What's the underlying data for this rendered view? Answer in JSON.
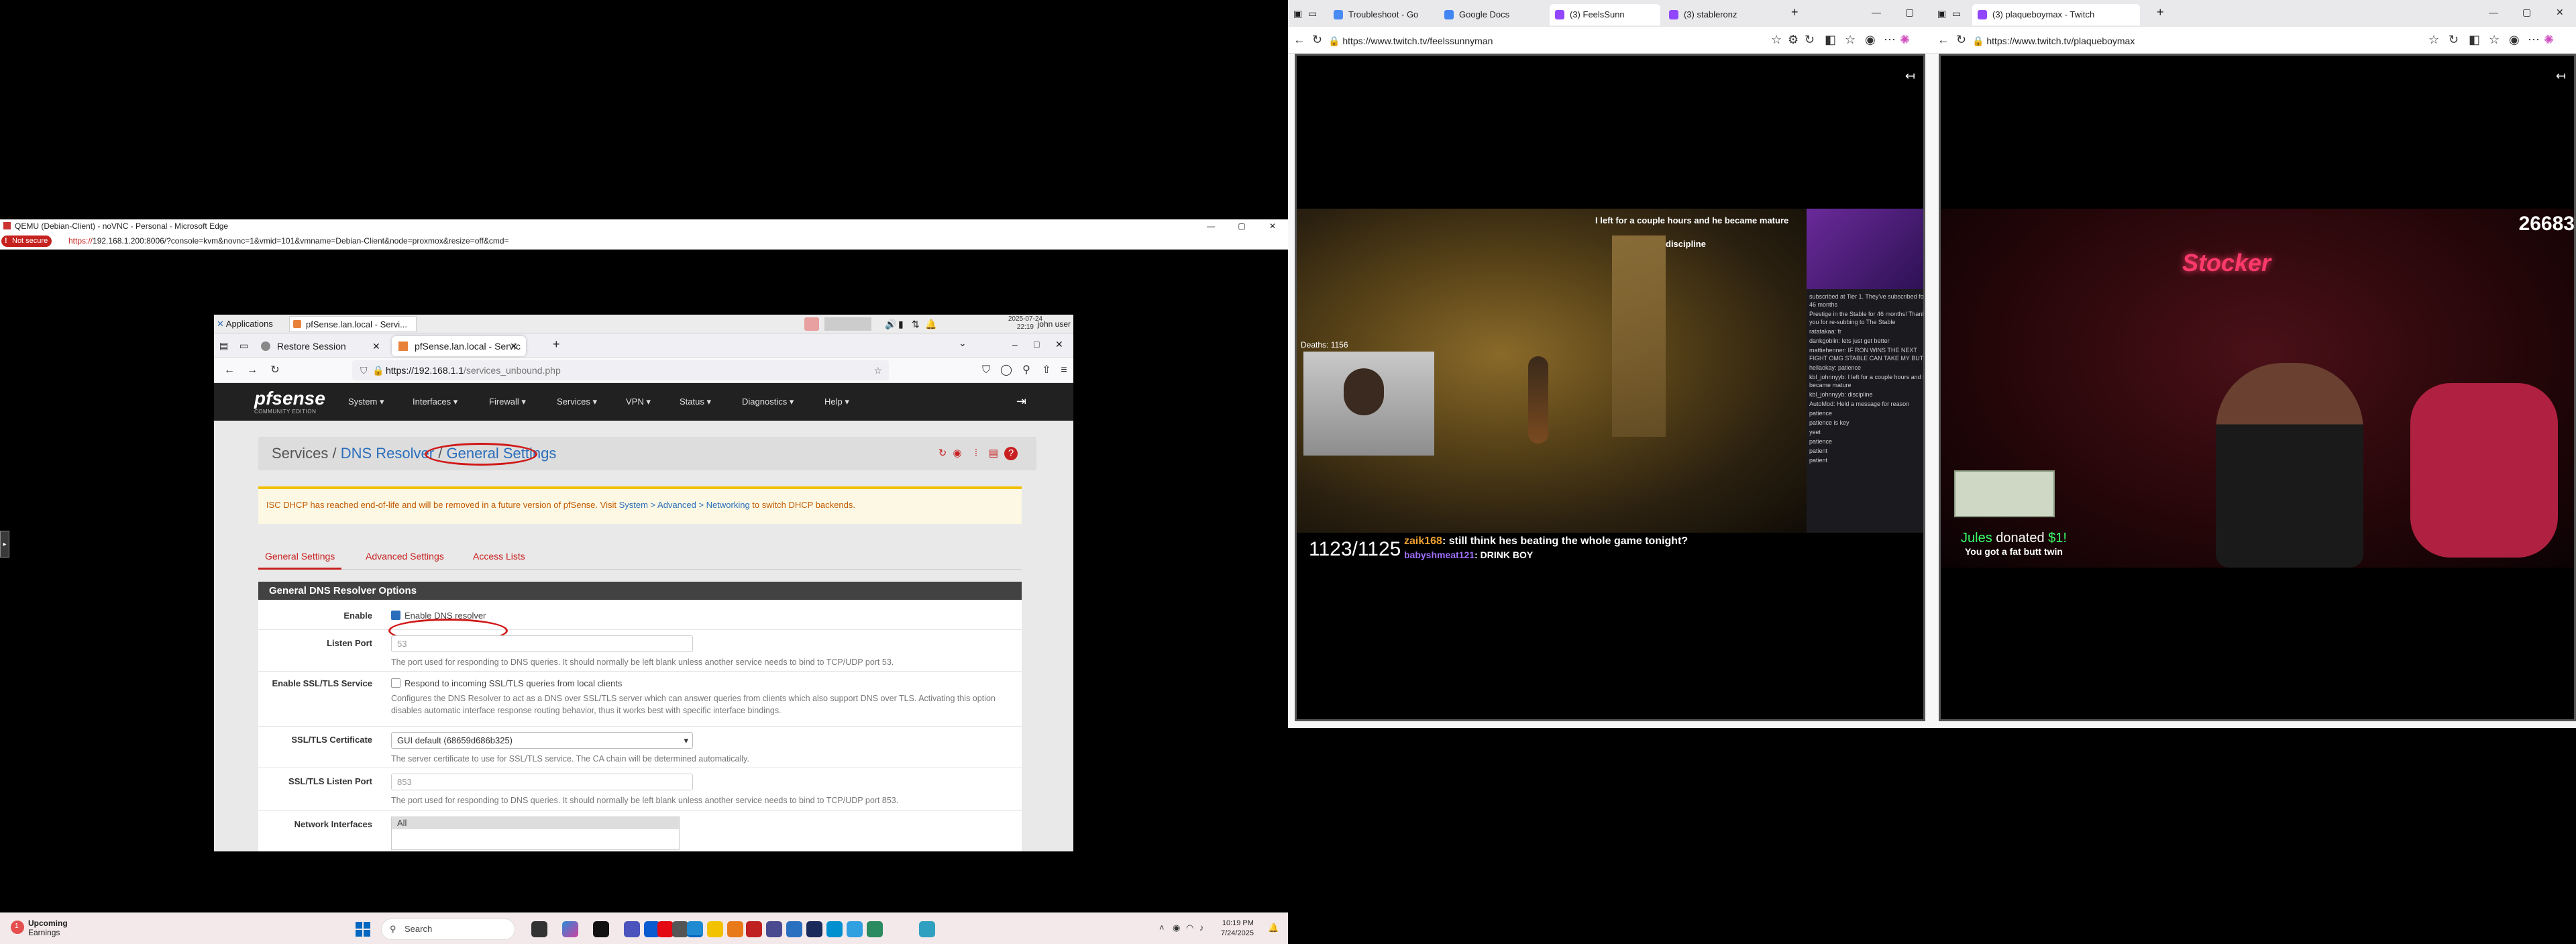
{
  "left_window": {
    "title": "QEMU (Debian-Client) - noVNC - Personal - Microsoft Edge",
    "not_secure": "Not secure",
    "url_scheme": "https://",
    "url_rest": "192.168.1.200:8006/?console=kvm&novnc=1&vmid=101&vmname=Debian-Client&node=proxmox&resize=off&cmd=",
    "controls": [
      "—",
      "▢",
      "✕"
    ],
    "vnc_handle": "▸"
  },
  "xfce": {
    "applications": "Applications",
    "task_label": "pfSense.lan.local - Servi...",
    "date": "2025-07-24",
    "time": "22:19",
    "user": "john user"
  },
  "firefox": {
    "tabs": [
      {
        "label": "Restore Session",
        "close": "✕"
      },
      {
        "label": "pfSense.lan.local - Servic",
        "close": "✕"
      }
    ],
    "new_tab": "+",
    "url_host": "https://192.168.1.1",
    "url_path": "/services_unbound.php",
    "win_controls": [
      "–",
      "□",
      "✕"
    ],
    "chevron": "⌄"
  },
  "pfsense": {
    "logo": "pfsense",
    "logo_sub": "COMMUNITY EDITION",
    "menu": [
      "System ▾",
      "Interfaces ▾",
      "Firewall ▾",
      "Services ▾",
      "VPN ▾",
      "Status ▾",
      "Diagnostics ▾",
      "Help ▾"
    ],
    "breadcrumb": {
      "part1": "Services",
      "sep1": "/",
      "part2": "DNS Resolver",
      "sep2": "/",
      "part3": "General Settings"
    },
    "warning_pre": "ISC DHCP has reached end-of-life and will be removed in a future version of pfSense. Visit ",
    "warning_link": "System > Advanced > Networking",
    "warning_post": " to switch DHCP backends.",
    "tabs": [
      "General Settings",
      "Advanced Settings",
      "Access Lists"
    ],
    "panel_title": "General DNS Resolver Options",
    "enable_label": "Enable",
    "enable_text": "Enable DNS resolver",
    "listen_port_label": "Listen Port",
    "listen_port_placeholder": "53",
    "listen_port_help": "The port used for responding to DNS queries. It should normally be left blank unless another service needs to bind to TCP/UDP port 53.",
    "ssl_label": "Enable SSL/TLS Service",
    "ssl_text": "Respond to incoming SSL/TLS queries from local clients",
    "ssl_help": "Configures the DNS Resolver to act as a DNS over SSL/TLS server which can answer queries from clients which also support DNS over TLS. Activating this option disables automatic interface response routing behavior, thus it works best with specific interface bindings.",
    "cert_label": "SSL/TLS Certificate",
    "cert_value": "GUI default (68659d686b325)",
    "cert_help": "The server certificate to use for SSL/TLS service. The CA chain will be determined automatically.",
    "ssl_port_label": "SSL/TLS Listen Port",
    "ssl_port_placeholder": "853",
    "ssl_port_help": "The port used for responding to DNS queries. It should normally be left blank unless another service needs to bind to TCP/UDP port 853.",
    "netif_label": "Network Interfaces",
    "netif_first": "All"
  },
  "taskbar": {
    "weather_title": "Upcoming",
    "weather_sub": "Earnings",
    "weather_badge": "1",
    "search": "Search",
    "time": "10:19 PM",
    "date": "7/24/2025"
  },
  "twitch1": {
    "tabs": [
      "Troubleshoot - Go",
      "Google Docs",
      "(3) FeelsSunn",
      "(3) stableronz"
    ],
    "url": "https://www.twitch.tv/feelssunnyman",
    "theater": "↤",
    "deaths": "Deaths: 1156",
    "counter": "1123/1125",
    "chat_line1_user": "zaik168",
    "chat_line1_msg": ": still think hes beating the whole game tonight?",
    "chat_line2_user": "babyshmeat121",
    "chat_line2_msg": ": DRINK BOY",
    "overlay_caption": "I left for a couple hours and he became mature",
    "overlay_caption2": "discipline",
    "chat_lines": [
      "subscribed at Tier 1. They've subscribed for 46 months",
      "Prestige in the Stable for 46 months! Thank you for re-subbing to The Stable",
      "ratatakaa: fr",
      "dankgoblin: lets just get better",
      "mattiehenner: IF RON WINS THE NEXT FIGHT OMG STABLE CAN TAKE MY BUTT",
      "hellaokay: patience",
      "kbl_johnnyyb: I left for a couple hours and he became mature",
      "kbl_johnnyyb: discipline",
      "AutoMod: Held a message for reason",
      "patience",
      "patience is key",
      "yeet",
      "patience",
      "patient",
      "patient"
    ]
  },
  "twitch2": {
    "tabs": [
      "(3) plaqueboymax - Twitch"
    ],
    "url": "https://www.twitch.tv/plaqueboymax",
    "theater": "↤",
    "sub_count": "26683",
    "donor": "Jules",
    "donated": "donated",
    "amount": "$1!",
    "donate_msg": "You got a fat butt twin",
    "neon": "Stocker"
  }
}
